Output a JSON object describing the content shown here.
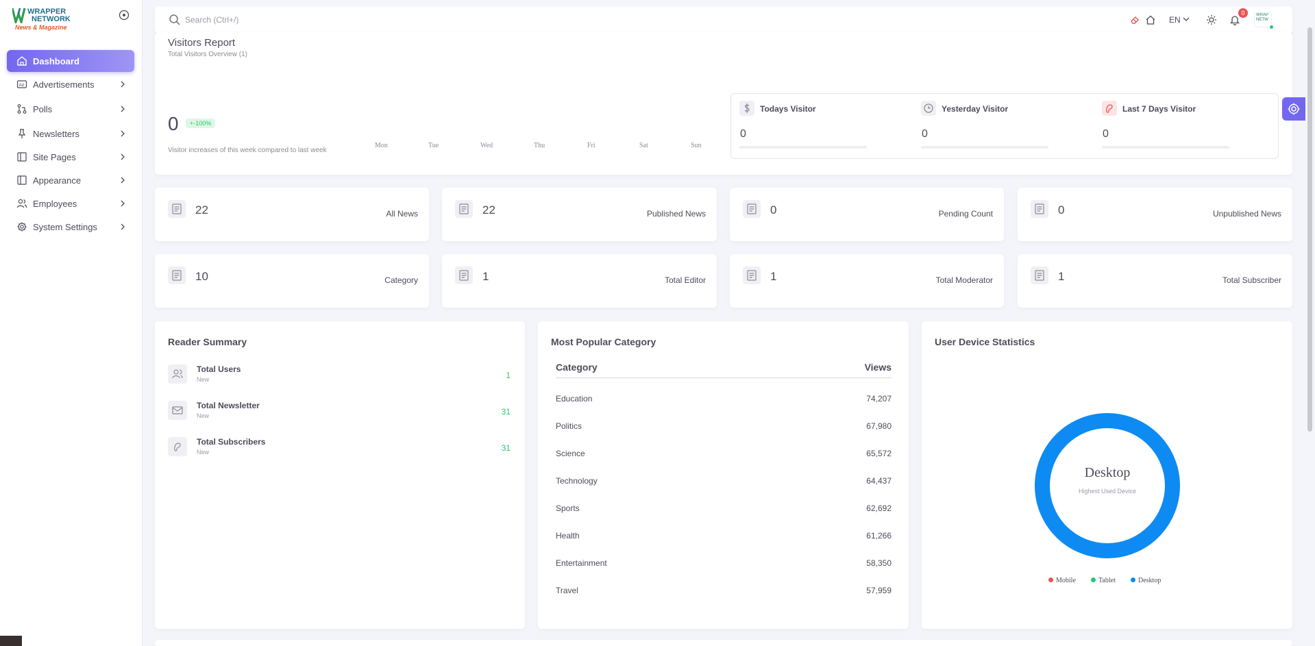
{
  "brand": {
    "title_line1": "WRAPPER",
    "title_line2": "NETWORK",
    "subtitle": "News & Magazine"
  },
  "sidebar": {
    "items": [
      {
        "label": "Dashboard",
        "icon": "home-icon",
        "active": true
      },
      {
        "label": "Advertisements",
        "icon": "ad-icon"
      },
      {
        "label": "Polls",
        "icon": "polls-icon"
      },
      {
        "label": "Newsletters",
        "icon": "pin-icon"
      },
      {
        "label": "Site Pages",
        "icon": "pages-icon"
      },
      {
        "label": "Appearance",
        "icon": "layout-icon"
      },
      {
        "label": "Employees",
        "icon": "users-icon"
      },
      {
        "label": "System Settings",
        "icon": "gear-icon"
      }
    ]
  },
  "topbar": {
    "search_placeholder": "Search (Ctrl+/)",
    "language": "EN",
    "notification_count": "0",
    "avatar_text": "WRAP NETW"
  },
  "visitors": {
    "title": "Visitors Report",
    "subtitle": "Total Visitors Overview (1)",
    "count": "0",
    "change": "+-100%",
    "note": "Visitor increases of this week compared to last week",
    "days": [
      "Mon",
      "Tue",
      "Wed",
      "Thu",
      "Fri",
      "Sat",
      "Sun"
    ],
    "todays_label": "Todays Visitor",
    "todays_value": "0",
    "yesterday_label": "Yesterday Visitor",
    "yesterday_value": "0",
    "last7_label": "Last 7 Days Visitor",
    "last7_value": "0"
  },
  "stats": [
    {
      "value": "22",
      "label": "All News"
    },
    {
      "value": "22",
      "label": "Published News"
    },
    {
      "value": "0",
      "label": "Pending Count"
    },
    {
      "value": "0",
      "label": "Unpublished News"
    },
    {
      "value": "10",
      "label": "Category"
    },
    {
      "value": "1",
      "label": "Total Editor"
    },
    {
      "value": "1",
      "label": "Total Moderator"
    },
    {
      "value": "1",
      "label": "Total Subscriber"
    }
  ],
  "reader_summary": {
    "title": "Reader Summary",
    "rows": [
      {
        "label": "Total Users",
        "sub": "New",
        "value": "1"
      },
      {
        "label": "Total Newsletter",
        "sub": "New",
        "value": "31"
      },
      {
        "label": "Total Subscribers",
        "sub": "New",
        "value": "31"
      }
    ]
  },
  "popular": {
    "title": "Most Popular Category",
    "col_category": "Category",
    "col_views": "Views",
    "rows": [
      {
        "name": "Education",
        "views": "74,207"
      },
      {
        "name": "Politics",
        "views": "67,980"
      },
      {
        "name": "Science",
        "views": "65,572"
      },
      {
        "name": "Technology",
        "views": "64,437"
      },
      {
        "name": "Sports",
        "views": "62,692"
      },
      {
        "name": "Health",
        "views": "61,266"
      },
      {
        "name": "Entertainment",
        "views": "58,350"
      },
      {
        "name": "Travel",
        "views": "57,959"
      }
    ]
  },
  "device": {
    "title": "User Device Statistics",
    "center_title": "Desktop",
    "center_sub": "Highest Used Device",
    "legend": [
      {
        "label": "Mobile",
        "color": "#ea5455"
      },
      {
        "label": "Tablet",
        "color": "#28c76f"
      },
      {
        "label": "Desktop",
        "color": "#0d8bf2"
      }
    ]
  },
  "colors": {
    "accent": "#7367f0",
    "success": "#28c76f",
    "danger": "#ea5455",
    "donut": "#0d8bf2"
  }
}
